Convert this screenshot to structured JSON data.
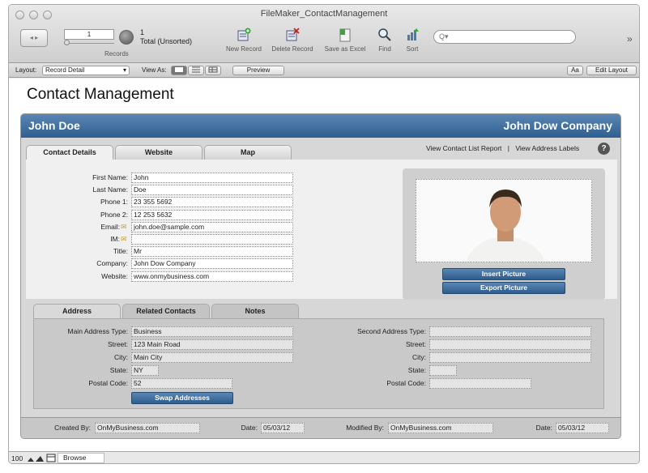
{
  "window": {
    "title": "FileMaker_ContactManagement"
  },
  "toolbar": {
    "record_number": "1",
    "records_label": "Records",
    "total_count": "1",
    "total_label": "Total (Unsorted)",
    "new_record": "New Record",
    "delete_record": "Delete Record",
    "save_as_excel": "Save as Excel",
    "find": "Find",
    "sort": "Sort",
    "search_placeholder": "Q▾",
    "overflow": "»"
  },
  "layoutbar": {
    "layout_label": "Layout:",
    "layout_value": "Record Detail",
    "view_as_label": "View As:",
    "preview": "Preview",
    "font_button": "Aa",
    "edit_layout": "Edit Layout"
  },
  "page": {
    "title": "Contact Management",
    "contact_name": "John Doe",
    "company_name": "John Dow Company"
  },
  "top_tabs": [
    "Contact Details",
    "Website",
    "Map"
  ],
  "links": {
    "list_report": "View Contact List Report",
    "separator": "|",
    "address_labels": "View Address Labels",
    "help": "?"
  },
  "contact": {
    "fields": [
      {
        "label": "First Name:",
        "value": "John"
      },
      {
        "label": "Last Name:",
        "value": "Doe"
      },
      {
        "label": "Phone 1:",
        "value": "23 355 5692"
      },
      {
        "label": "Phone 2:",
        "value": "12 253 5632"
      },
      {
        "label": "Email:",
        "value": "john.doe@sample.com"
      },
      {
        "label": "IM:",
        "value": ""
      },
      {
        "label": "Title:",
        "value": "Mr"
      },
      {
        "label": "Company:",
        "value": "John Dow Company"
      },
      {
        "label": "Website:",
        "value": "www.onmybusiness.com"
      }
    ]
  },
  "picture": {
    "insert": "Insert Picture",
    "export": "Export Picture"
  },
  "bottom_tabs": [
    "Address",
    "Related Contacts",
    "Notes"
  ],
  "address": {
    "main_type_label": "Main Address Type:",
    "main_type": "Business",
    "street_label": "Street:",
    "street": "123 Main Road",
    "city_label": "City:",
    "city": "Main City",
    "state_label": "State:",
    "state": "NY",
    "postal_label": "Postal Code:",
    "postal": "52",
    "swap": "Swap Addresses",
    "second_type_label": "Second Address Type:",
    "second_street_label": "Street:",
    "second_city_label": "City:",
    "second_state_label": "State:",
    "second_postal_label": "Postal Code:"
  },
  "footer": {
    "created_by_label": "Created By:",
    "created_by": "OnMyBusiness.com",
    "date_label": "Date:",
    "created_date": "05/03/12",
    "modified_by_label": "Modified By:",
    "modified_by": "OnMyBusiness.com",
    "modified_date_label": "Date:",
    "modified_date": "05/03/12"
  },
  "statusbar": {
    "zoom": "100",
    "mode": "Browse"
  },
  "colors": {
    "header_blue": "#3d6d9c",
    "button_blue": "#2d5c8c"
  }
}
